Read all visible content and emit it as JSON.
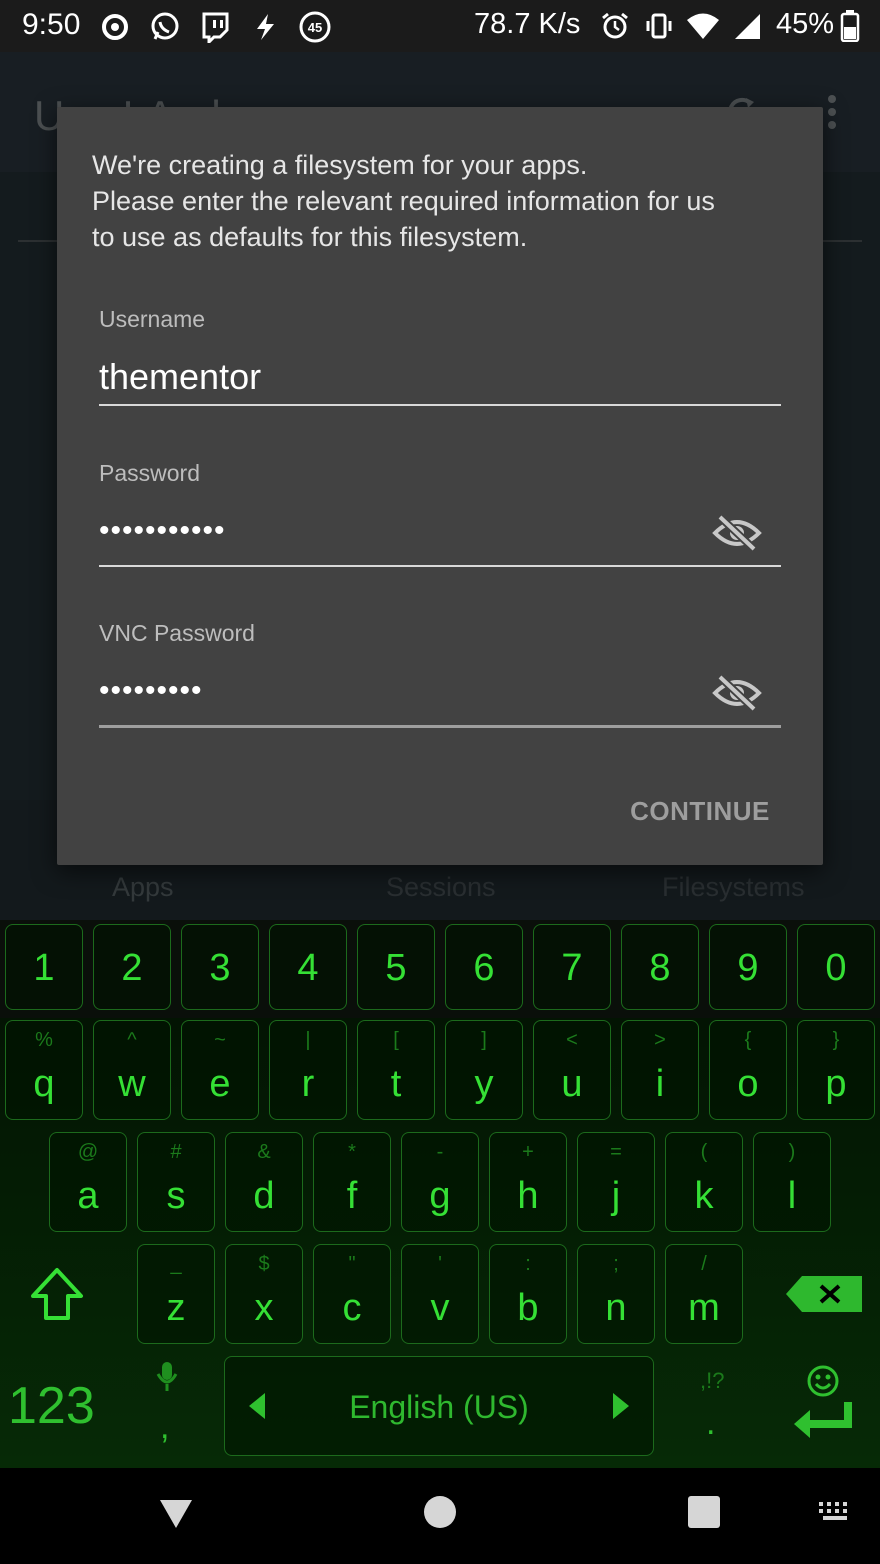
{
  "status_bar": {
    "time": "9:50",
    "net_speed": "78.7 K/s",
    "battery": "45%",
    "badge": "45",
    "left_icons": [
      "opera-icon",
      "whatsapp-icon",
      "twitch-icon",
      "flash-icon",
      "badge-45-icon"
    ],
    "right_icons": [
      "alarm-icon",
      "vibrate-icon",
      "wifi-icon",
      "signal-icon",
      "battery-icon"
    ]
  },
  "app": {
    "title": "UserLAnd",
    "tabs": [
      "Apps",
      "Sessions",
      "Filesystems"
    ]
  },
  "dialog": {
    "message_lines": [
      "We're creating a filesystem for your apps.",
      "Please enter the relevant required information for us",
      "to use as defaults for this filesystem."
    ],
    "username_label": "Username",
    "username_value": "thementor",
    "password_label": "Password",
    "password_value": "•••••••••••",
    "vnc_label": "VNC Password",
    "vnc_value": "•••••••••",
    "continue_label": "CONTINUE"
  },
  "keyboard": {
    "number_row": [
      "1",
      "2",
      "3",
      "4",
      "5",
      "6",
      "7",
      "8",
      "9",
      "0"
    ],
    "row1": [
      {
        "key": "q",
        "alt": "%"
      },
      {
        "key": "w",
        "alt": "^"
      },
      {
        "key": "e",
        "alt": "~"
      },
      {
        "key": "r",
        "alt": "|"
      },
      {
        "key": "t",
        "alt": "["
      },
      {
        "key": "y",
        "alt": "]"
      },
      {
        "key": "u",
        "alt": "<"
      },
      {
        "key": "i",
        "alt": ">"
      },
      {
        "key": "o",
        "alt": "{"
      },
      {
        "key": "p",
        "alt": "}"
      }
    ],
    "row2": [
      {
        "key": "a",
        "alt": "@"
      },
      {
        "key": "s",
        "alt": "#"
      },
      {
        "key": "d",
        "alt": "&"
      },
      {
        "key": "f",
        "alt": "*"
      },
      {
        "key": "g",
        "alt": "-"
      },
      {
        "key": "h",
        "alt": "+"
      },
      {
        "key": "j",
        "alt": "="
      },
      {
        "key": "k",
        "alt": "("
      },
      {
        "key": "l",
        "alt": ")"
      }
    ],
    "row3": [
      {
        "key": "z",
        "alt": "_"
      },
      {
        "key": "x",
        "alt": "$"
      },
      {
        "key": "c",
        "alt": "\""
      },
      {
        "key": "v",
        "alt": "'"
      },
      {
        "key": "b",
        "alt": ":"
      },
      {
        "key": "n",
        "alt": ";"
      },
      {
        "key": "m",
        "alt": "/"
      }
    ],
    "symbols_label": "123",
    "comma": ",",
    "space_label": "English (US)",
    "punct_top": ",!?",
    "period": ".",
    "accent_color": "#35e035"
  }
}
